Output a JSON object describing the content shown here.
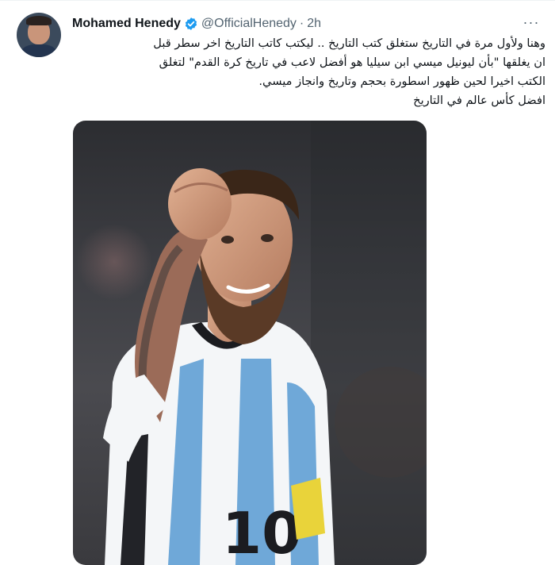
{
  "tweet": {
    "author_name": "Mohamed Henedy",
    "handle": "@OfficialHenedy",
    "separator": "·",
    "time": "2h",
    "more_label": "···",
    "text_lines": [
      "وهنا ولأول مرة في التاريخ ستغلق كتب التاريخ .. ليكتب كاتب التاريخ اخر سطر  قبل",
      "ان يغلقها \"بأن ليونيل ميسي ابن سيليا هو أفضل لاعب في تاريخ كرة القدم\" لتغلق",
      "الكتب اخيرا لحين ظهور اسطورة بحجم وتاريخ وانجاز ميسي.",
      "افضل كأس عالم في التاريخ"
    ],
    "icons": {
      "verified": "verified-badge-icon",
      "more": "more-options-icon"
    },
    "accent_color": "#1d9bf0"
  }
}
